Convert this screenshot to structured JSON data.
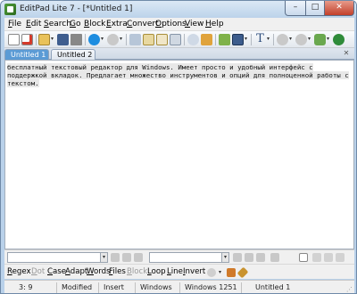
{
  "window": {
    "title": "EditPad Lite 7 - [*Untitled 1]",
    "min_glyph": "–",
    "max_glyph": "□",
    "close_glyph": "✕"
  },
  "menu": {
    "items": [
      {
        "ul": "F",
        "rest": "ile"
      },
      {
        "ul": "E",
        "rest": "dit"
      },
      {
        "ul": "S",
        "rest": "earch"
      },
      {
        "ul": "G",
        "rest": "o"
      },
      {
        "ul": "B",
        "rest": "lock"
      },
      {
        "ul": "E",
        "rest": "xtra"
      },
      {
        "ul": "C",
        "rest": "onvert"
      },
      {
        "ul": "O",
        "rest": "ptions"
      },
      {
        "ul": "V",
        "rest": "iew"
      },
      {
        "ul": "H",
        "rest": "elp"
      }
    ]
  },
  "toolbar": {
    "icons": [
      "new-file-icon",
      "open-file-icon",
      "save-icon",
      "print-icon",
      "skype-icon",
      "spell-icon",
      "cut-icon",
      "copy-icon",
      "paste-icon",
      "undo-icon",
      "find-icon",
      "replace-icon",
      "block-select-icon",
      "font-icon",
      "clip-icon",
      "tools-icon",
      "globe-icon"
    ]
  },
  "tabs": [
    {
      "label": "Untitled 1",
      "active": true
    },
    {
      "label": "Untitled 2",
      "active": false,
      "close_glyph": "✕"
    }
  ],
  "tabbar": {
    "close_all_glyph": "✕"
  },
  "editor": {
    "line1": "бесплатный текстовый редактор для Windows. Имеет просто и удобный интерфейс с",
    "line2": "поддержкой вкладок. Предлагает множество инструментов и опций для полноценной работы с",
    "line3": "текстом."
  },
  "search": {
    "find_value": "",
    "replace_value": "",
    "dropdown_glyph": "▾"
  },
  "options": {
    "items": [
      {
        "ul": "R",
        "rest": "egex",
        "enabled": true
      },
      {
        "ul": "D",
        "rest": "ot",
        "enabled": false
      },
      {
        "ul": "C",
        "rest": "ase",
        "enabled": true
      },
      {
        "ul": "A",
        "rest": "dapt",
        "enabled": true
      },
      {
        "ul": "W",
        "rest": "ords",
        "enabled": true
      },
      {
        "ul": "F",
        "rest": "iles",
        "enabled": true
      },
      {
        "ul": "B",
        "rest": "lock",
        "enabled": false
      },
      {
        "ul": "L",
        "rest": "oop",
        "enabled": true
      },
      {
        "ul": "L",
        "rest": "ine",
        "enabled": true
      },
      {
        "ul": "I",
        "rest": "nvert",
        "enabled": true
      }
    ]
  },
  "status": {
    "position": "3: 9",
    "modified": "Modified",
    "insert": "Insert",
    "line_break": "Windows",
    "encoding": "Windows 1251",
    "tab_name": "Untitled 1"
  },
  "colors": {
    "active_tab": "#5b9bd5",
    "editor_highlight": "#e8e8e8"
  }
}
